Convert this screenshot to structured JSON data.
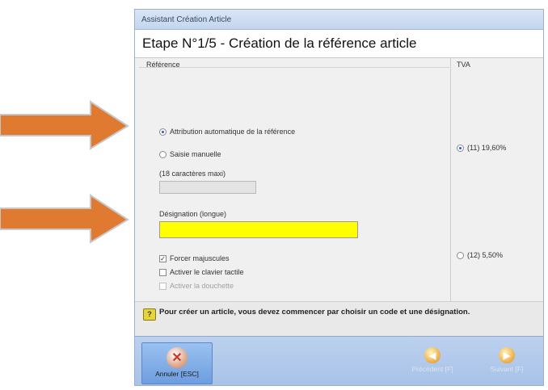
{
  "window": {
    "title": "Assistant Création Article",
    "step_title": "Etape N°1/5 - Création de la référence article"
  },
  "reference_panel": {
    "label": "Référence",
    "radio_auto": "Attribution automatique de la référence",
    "radio_manual": "Saisie manuelle",
    "max_chars_label": "(18 caractères maxi)",
    "designation_label": "Désignation (longue)",
    "designation_value": "",
    "check_uppercase": "Forcer majuscules",
    "check_uppercase_checked": true,
    "check_touch_keyboard": "Activer le clavier tactile",
    "check_scanner": "Activer la douchette"
  },
  "tva_panel": {
    "label": "TVA",
    "option_1": "(11) 19,60%",
    "option_2": "(12) 5,50%"
  },
  "info": {
    "icon": "info-icon",
    "text": "Pour créer un article, vous devez commencer par choisir un code et une désignation."
  },
  "toolbar": {
    "cancel_label": "Annuler [ESC]",
    "prev_label": "Précédent [F]",
    "next_label": "Suivant [F]"
  },
  "colors": {
    "arrow": "#e07a30",
    "designation_bg": "#ffff00",
    "toolbar_bg": "#a7c2e8"
  }
}
